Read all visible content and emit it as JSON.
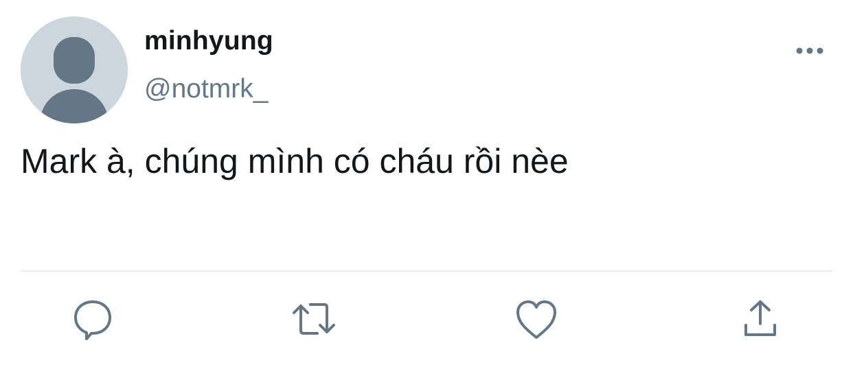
{
  "tweet": {
    "display_name": "minhyung",
    "handle": "@notmrk_",
    "text": "Mark à, chúng mình có cháu rồi nèe"
  },
  "icons": {
    "avatar": "default-avatar-icon",
    "more": "more-options-icon",
    "reply": "reply-icon",
    "retweet": "retweet-icon",
    "like": "like-icon",
    "share": "share-icon"
  },
  "colors": {
    "text_primary": "#14171a",
    "text_secondary": "#657786",
    "icon_gray": "#657786",
    "avatar_bg": "#ccd6dd",
    "avatar_fg": "#657786",
    "divider": "#e6ecf0"
  }
}
